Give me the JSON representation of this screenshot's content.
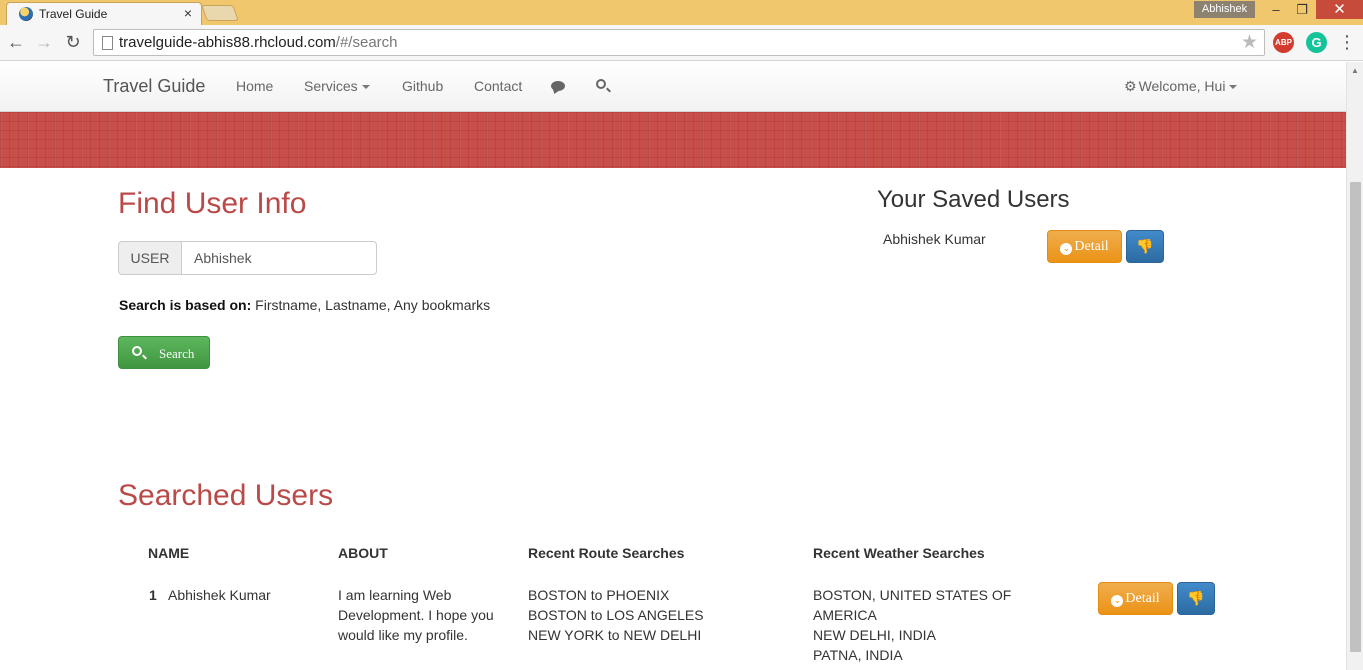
{
  "browser": {
    "tab_title": "Travel Guide",
    "tab_close": "×",
    "profile": "Abhishek",
    "url_host": "travelguide-abhis88.rhcloud.com",
    "url_path": "/#/search",
    "extensions": {
      "abp": "ABP",
      "grammarly": "G"
    },
    "window_controls": {
      "minimize": "–",
      "maximize": "❐",
      "close": "✕"
    }
  },
  "navbar": {
    "brand": "Travel Guide",
    "items": [
      "Home",
      "Services",
      "Github",
      "Contact"
    ],
    "welcome": "Welcome, Hui",
    "icons": [
      "comment-icon",
      "search-icon",
      "gear-icon"
    ]
  },
  "find": {
    "title": "Find User Info",
    "addon": "USER",
    "input_value": "Abhishek",
    "basis_label": "Search is based on:",
    "basis_text": " Firstname, Lastname, Any bookmarks",
    "search_button": "Search"
  },
  "saved": {
    "title": "Your Saved Users",
    "users": [
      {
        "name": "Abhishek Kumar",
        "detail_label": "Detail"
      }
    ]
  },
  "searched": {
    "title": "Searched Users",
    "columns": [
      "NAME",
      "ABOUT",
      "Recent Route Searches",
      "Recent Weather Searches"
    ],
    "rows": [
      {
        "num": "1",
        "name": "Abhishek Kumar",
        "about": "I am learning Web Development. I hope you would like my profile.",
        "routes": [
          "BOSTON to PHOENIX",
          "BOSTON to LOS ANGELES",
          "NEW YORK to NEW DELHI"
        ],
        "weather": [
          "BOSTON, UNITED STATES OF AMERICA",
          "NEW DELHI, INDIA",
          "PATNA, INDIA"
        ],
        "detail_label": "Detail"
      }
    ]
  },
  "colors": {
    "heading_red": "#b94a48",
    "banner": "#c84e4a",
    "success": "#5cb85c",
    "warning": "#f0ad4e",
    "primary": "#428bca",
    "chrome_frame": "#f0c76c"
  }
}
